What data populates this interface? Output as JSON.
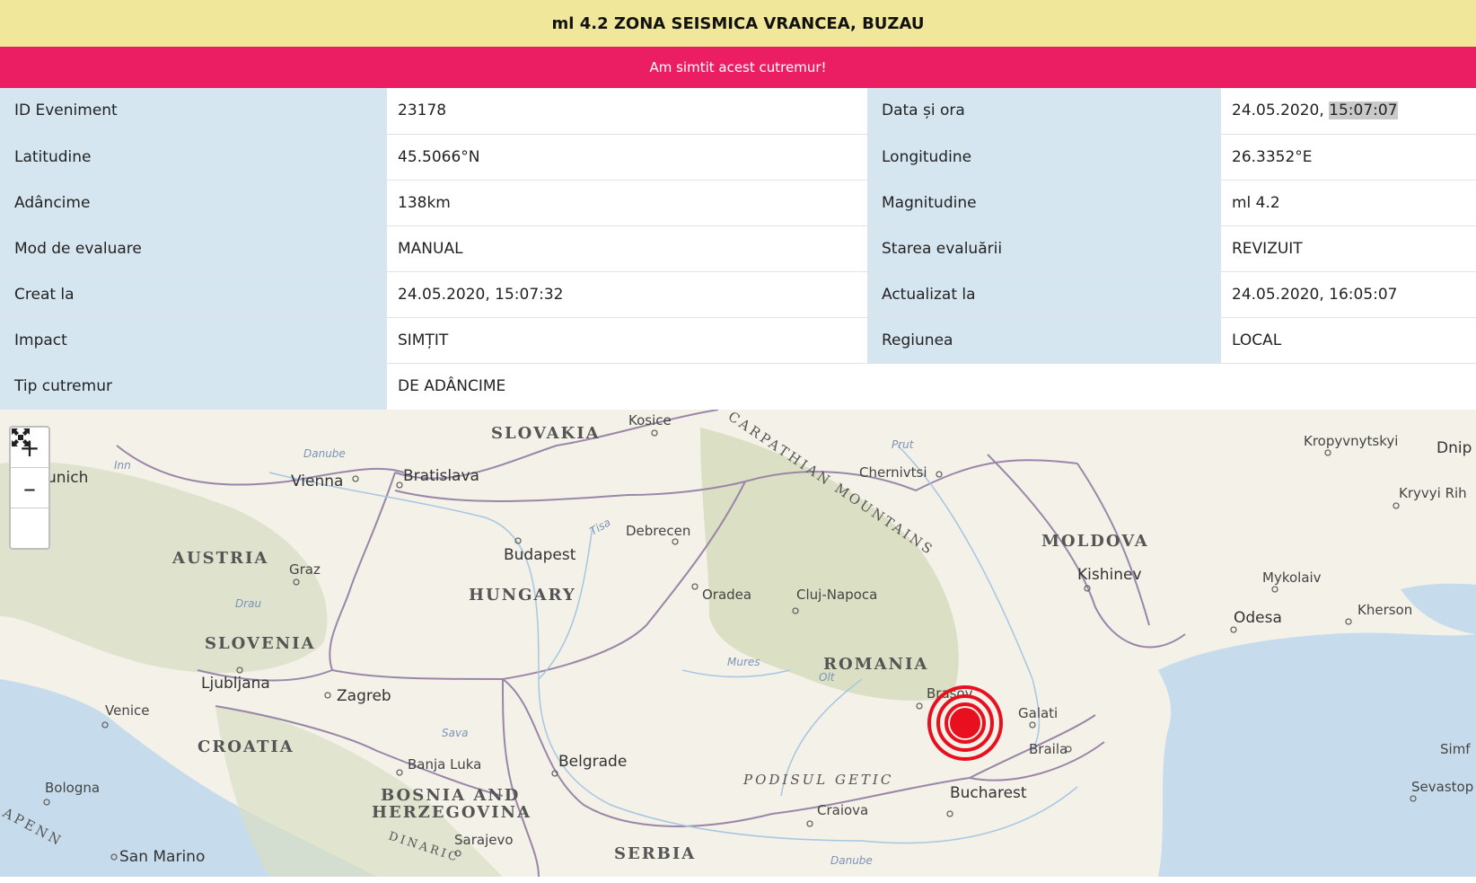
{
  "header": {
    "title": "ml 4.2 ZONA SEISMICA VRANCEA, BUZAU",
    "felt_button": "Am simtit acest cutremur!"
  },
  "details": {
    "rows": [
      {
        "l1": "ID Eveniment",
        "v1": "23178",
        "l2": "Data și ora",
        "v2_date": "24.05.2020, ",
        "v2_time": "15:07:07"
      },
      {
        "l1": "Latitudine",
        "v1": "45.5066°N",
        "l2": "Longitudine",
        "v2": "26.3352°E"
      },
      {
        "l1": "Adâncime",
        "v1": "138km",
        "l2": "Magnitudine",
        "v2": "ml 4.2"
      },
      {
        "l1": "Mod de evaluare",
        "v1": "MANUAL",
        "l2": "Starea evaluării",
        "v2": "REVIZUIT"
      },
      {
        "l1": "Creat la",
        "v1": "24.05.2020, 15:07:32",
        "l2": "Actualizat la",
        "v2": "24.05.2020, 16:05:07"
      },
      {
        "l1": "Impact",
        "v1": "SIMȚIT",
        "l2": "Regiunea",
        "v2": "LOCAL"
      },
      {
        "l1": "Tip cutremur",
        "v1": "DE ADÂNCIME"
      }
    ]
  },
  "map": {
    "controls": {
      "zoom_in": "+",
      "zoom_out": "–",
      "fullscreen": "fullscreen-icon"
    },
    "countries": [
      "SLOVAKIA",
      "AUSTRIA",
      "HUNGARY",
      "SLOVENIA",
      "CROATIA",
      "ROMANIA",
      "MOLDOVA",
      "BOSNIA AND",
      "HERZEGOVINA",
      "SERBIA"
    ],
    "cities": [
      "Kosice",
      "unich",
      "Vienna",
      "Bratislava",
      "Chernivtsi",
      "Kropyvnytskyi",
      "Dnip",
      "Kryvyi Rih",
      "Budapest",
      "Debrecen",
      "Graz",
      "Oradea",
      "Cluj-Napoca",
      "Kishinev",
      "Mykolaiv",
      "Odesa",
      "Kherson",
      "Ljubljana",
      "Zagreb",
      "Venice",
      "Brasov",
      "Galati",
      "Braila",
      "Banja Luka",
      "Belgrade",
      "Bologna",
      "Bucharest",
      "Craiova",
      "Sarajevo",
      "San Marino",
      "Simf",
      "Sevastop"
    ],
    "water": [
      "Danube",
      "Inn",
      "Tisa",
      "Prut",
      "Drau",
      "Mures",
      "Olt",
      "Sava",
      "Danube"
    ],
    "ranges": [
      "CARPATHIAN MOUNTAINS",
      "PODISUL GETIC",
      "APENN",
      "DINARIC"
    ],
    "epicenter_color": "#e8101e"
  }
}
